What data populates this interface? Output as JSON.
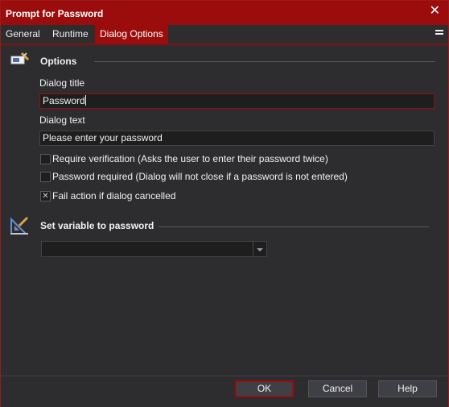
{
  "window": {
    "title": "Prompt for Password"
  },
  "tabs": [
    {
      "label": "General"
    },
    {
      "label": "Runtime"
    },
    {
      "label": "Dialog Options"
    }
  ],
  "options": {
    "section_title": "Options",
    "dialog_title_label": "Dialog title",
    "dialog_title_value": "Password",
    "dialog_text_label": "Dialog text",
    "dialog_text_value": "Please enter your password",
    "checkboxes": [
      {
        "label": "Require verification (Asks the user to enter their password twice)",
        "checked": false
      },
      {
        "label": "Password required (Dialog will not close if a password is not entered)",
        "checked": false
      },
      {
        "label": "Fail action if dialog cancelled",
        "checked": true
      }
    ]
  },
  "variable": {
    "section_title": "Set variable to password",
    "selected_value": ""
  },
  "footer": {
    "ok_label": "OK",
    "cancel_label": "Cancel",
    "help_label": "Help"
  },
  "colors": {
    "accent": "#9b0d0d",
    "background": "#2d2d30",
    "input_background": "#1e1e1e"
  }
}
